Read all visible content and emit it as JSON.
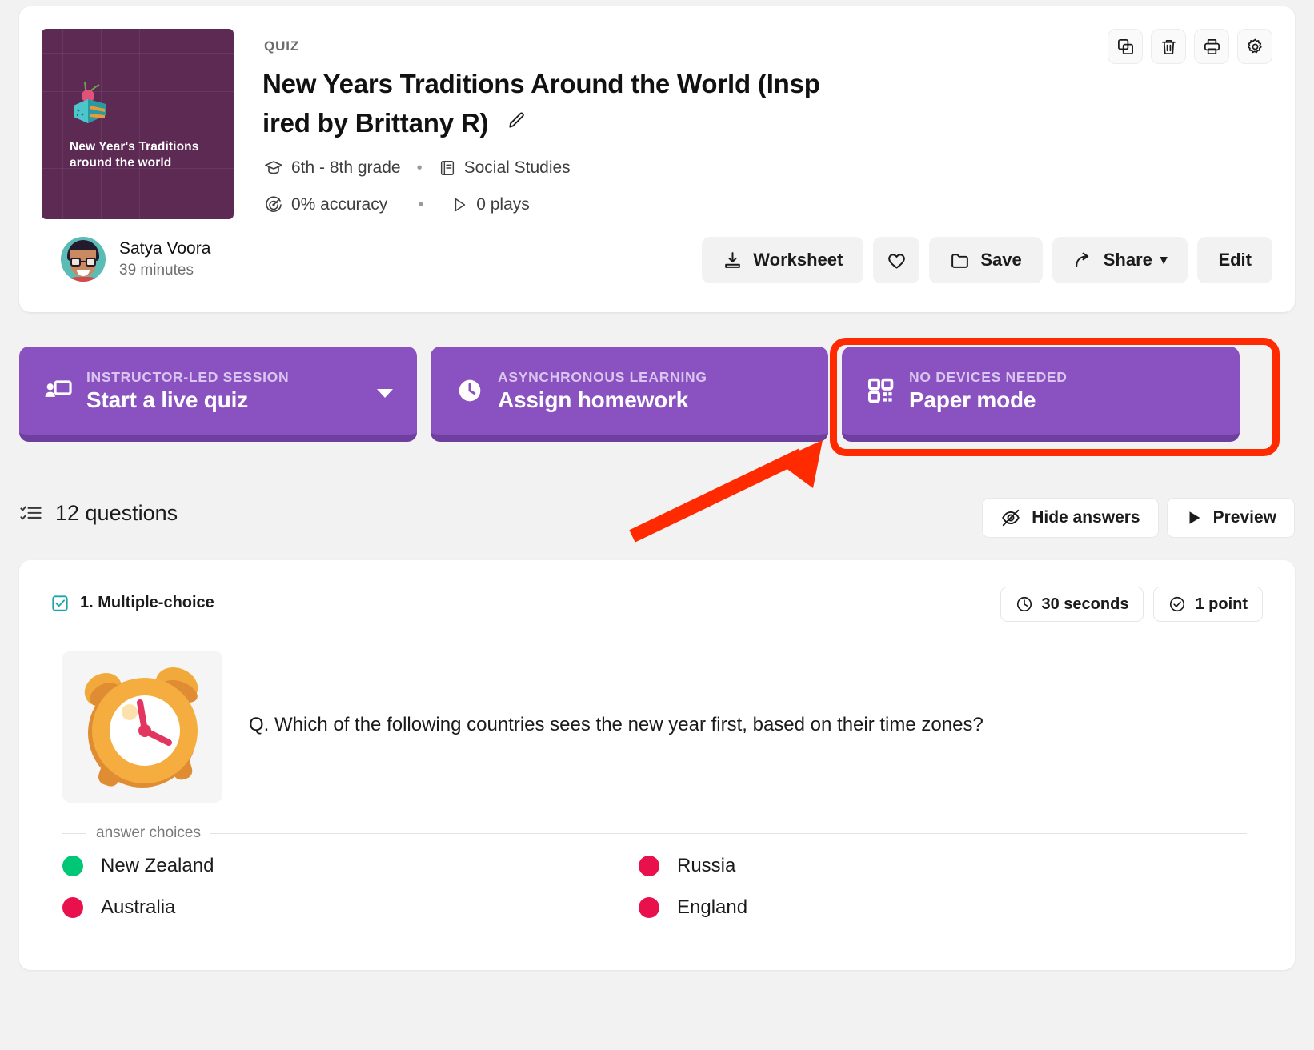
{
  "header": {
    "kicker": "QUIZ",
    "title": "New Years Traditions Around the World (Insp ired by Brittany R)",
    "edit_title_icon": "pencil-icon",
    "meta": {
      "grade": "6th - 8th grade",
      "subject": "Social Studies",
      "accuracy": "0% accuracy",
      "plays": "0 plays",
      "separator": "•"
    },
    "thumbnail": {
      "line1": "New Year's Traditions",
      "line2": "around the world",
      "bg_color": "#5d2a54",
      "art": "cake-slice-illustration"
    },
    "author": {
      "name": "Satya Voora",
      "time": "39 minutes",
      "avatar": "user-avatar"
    },
    "icon_buttons": [
      {
        "name": "copy-icon",
        "label": "Copy"
      },
      {
        "name": "trash-icon",
        "label": "Delete"
      },
      {
        "name": "print-icon",
        "label": "Print"
      },
      {
        "name": "gear-icon",
        "label": "Settings"
      }
    ],
    "actions": [
      {
        "name": "worksheet-button",
        "label": "Worksheet",
        "icon": "download-icon"
      },
      {
        "name": "favorite-button",
        "label": "",
        "icon": "heart-icon"
      },
      {
        "name": "save-button",
        "label": "Save",
        "icon": "folder-icon"
      },
      {
        "name": "share-button",
        "label": "Share",
        "icon": "share-arrow-icon",
        "caret": "▾"
      },
      {
        "name": "edit-button",
        "label": "Edit",
        "icon": ""
      }
    ]
  },
  "modes": [
    {
      "kicker": "INSTRUCTOR-LED SESSION",
      "title": "Start a live quiz",
      "icon": "presenter-screen-icon",
      "has_caret": true,
      "highlighted": false
    },
    {
      "kicker": "ASYNCHRONOUS LEARNING",
      "title": "Assign homework",
      "icon": "clock-icon",
      "has_caret": false,
      "highlighted": false
    },
    {
      "kicker": "NO DEVICES NEEDED",
      "title": "Paper mode",
      "icon": "qr-code-icon",
      "has_caret": false,
      "highlighted": true
    }
  ],
  "annotation": {
    "ring_color": "#ff2a00",
    "arrow_color": "#ff2a00",
    "points_to": "Paper mode"
  },
  "questions_bar": {
    "count_label": "12 questions",
    "list_icon": "checklist-icon",
    "hide_answers": {
      "label": "Hide answers",
      "icon": "eye-off-icon"
    },
    "preview": {
      "label": "Preview",
      "icon": "play-icon"
    }
  },
  "question": {
    "number_label": "1. Multiple-choice",
    "checkbox_icon": "checkbox-checked-icon",
    "time_chip": {
      "label": "30 seconds",
      "icon": "clock-icon"
    },
    "point_chip": {
      "label": "1 point",
      "icon": "check-circle-icon"
    },
    "media": "alarm-clock-illustration",
    "text": "Q. Which of the following countries sees the new year first, based on their time zones?",
    "choices_label": "answer choices",
    "choices": [
      {
        "label": "New Zealand",
        "color": "#00c775",
        "correct": true
      },
      {
        "label": "Russia",
        "color": "#e8114b",
        "correct": false
      },
      {
        "label": "Australia",
        "color": "#e8114b",
        "correct": false
      },
      {
        "label": "England",
        "color": "#e8114b",
        "correct": false
      }
    ]
  },
  "colors": {
    "purple": "#8a52c0",
    "purple_dark": "#6f3fa0",
    "page_bg": "#f2f2f2"
  }
}
